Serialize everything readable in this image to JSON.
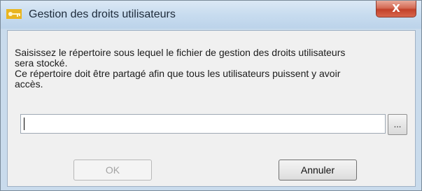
{
  "window": {
    "title": "Gestion des droits utilisateurs",
    "close_label": "X"
  },
  "message": {
    "line1": "Saisissez le répertoire sous lequel le fichier de gestion des droits utilisateurs",
    "line2": "sera stocké.",
    "line3": "Ce répertoire doit être partagé afin que tous les utilisateurs puissent y avoir",
    "line4": "accès."
  },
  "path_field": {
    "value": "",
    "placeholder": ""
  },
  "browse": {
    "label": "..."
  },
  "buttons": {
    "ok": "OK",
    "ok_enabled": false,
    "cancel": "Annuler"
  },
  "colors": {
    "titlebar": "#c8dcef",
    "close_button": "#c2412a",
    "client_background": "#f0f0f0",
    "key_icon": "#e9b51f"
  },
  "icons": {
    "app": "key-icon"
  }
}
